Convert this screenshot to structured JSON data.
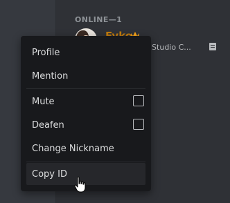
{
  "members": {
    "section_header": "ONLINE—1",
    "member": {
      "name": "Fyko",
      "activity": "isual Studio C..."
    }
  },
  "context_menu": {
    "items": [
      {
        "label": "Profile"
      },
      {
        "label": "Mention"
      },
      {
        "label": "Mute"
      },
      {
        "label": "Deafen"
      },
      {
        "label": "Change Nickname"
      },
      {
        "label": "Copy ID"
      }
    ]
  },
  "colors": {
    "menu_bg": "#18191c",
    "owner_name": "#c27c0e",
    "panel_bg": "#2f3136"
  }
}
